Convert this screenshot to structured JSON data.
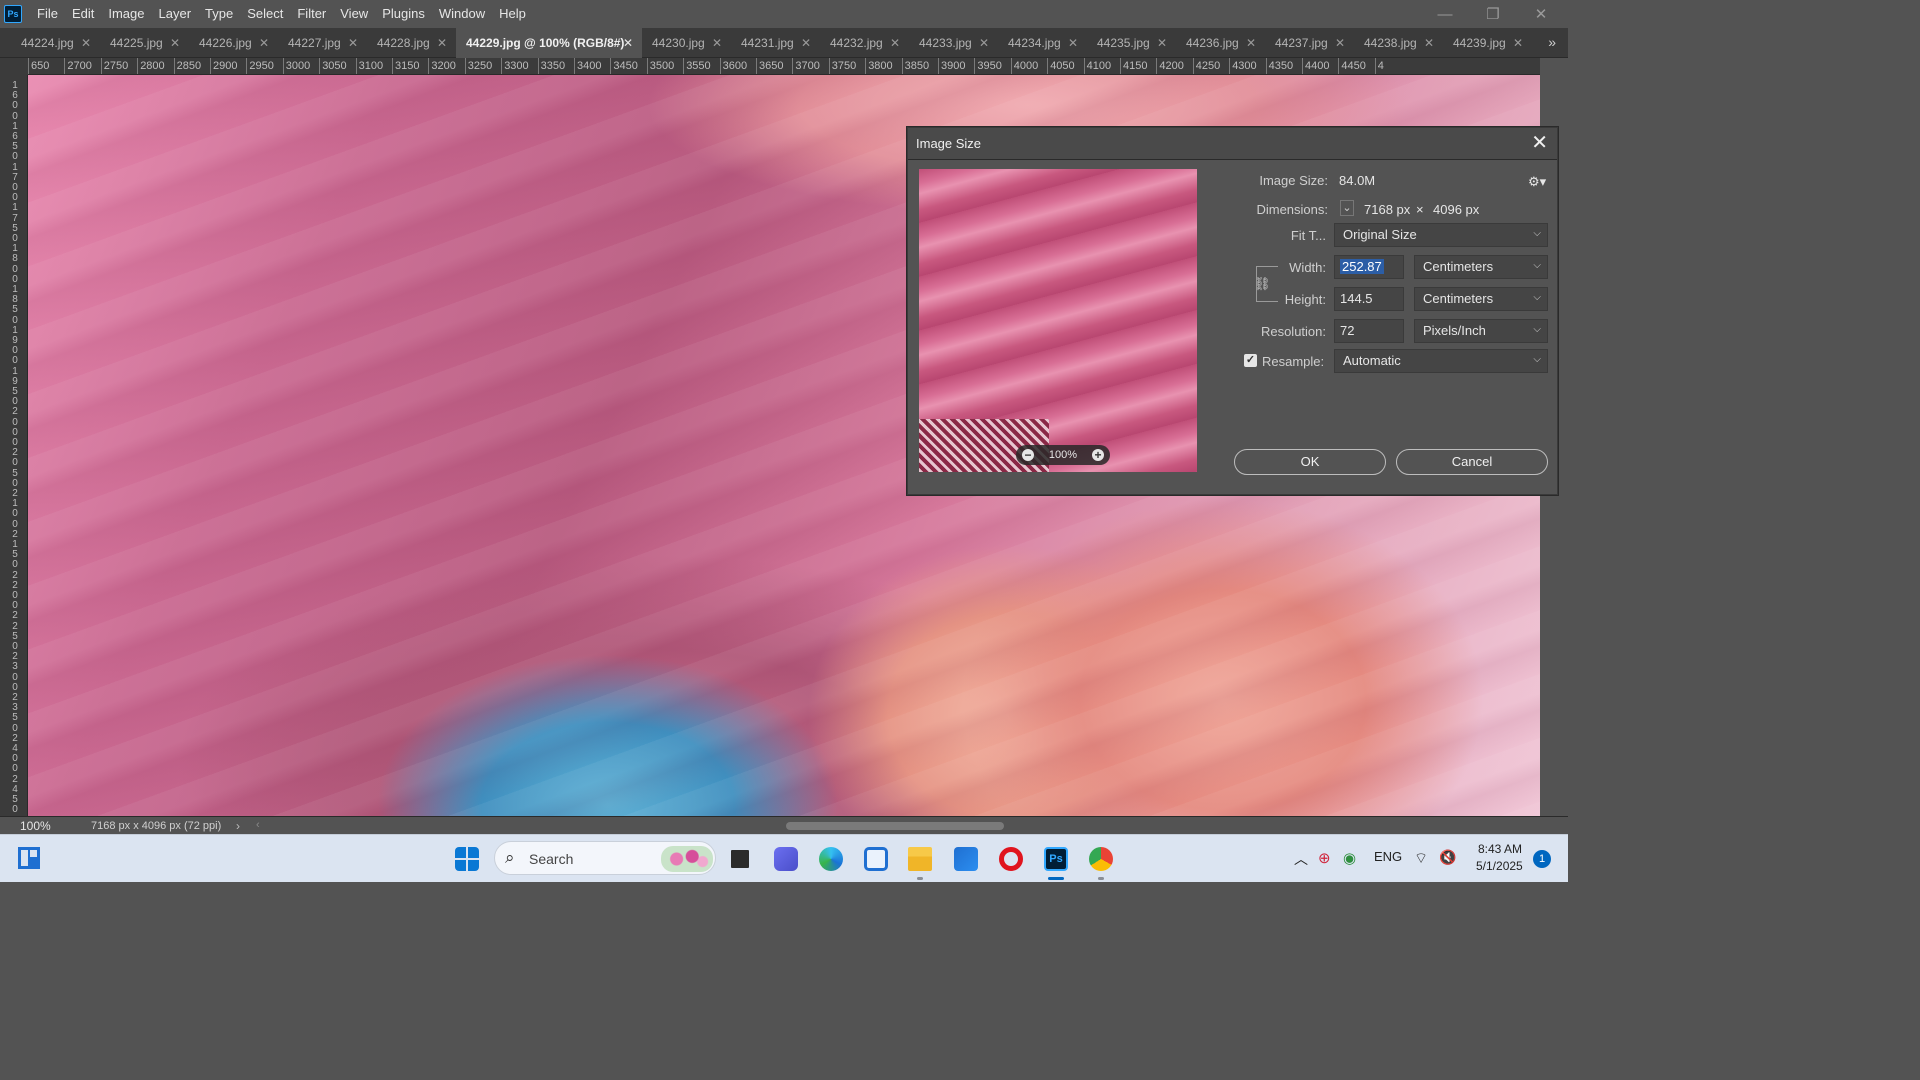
{
  "app": {
    "logo": "Ps",
    "menu": [
      "File",
      "Edit",
      "Image",
      "Layer",
      "Type",
      "Select",
      "Filter",
      "View",
      "Plugins",
      "Window",
      "Help"
    ],
    "window_controls": {
      "minimize": "—",
      "restore": "❐",
      "close": "✕"
    }
  },
  "tabs": [
    {
      "label": "44224.jpg",
      "active": false
    },
    {
      "label": "44225.jpg",
      "active": false
    },
    {
      "label": "44226.jpg",
      "active": false
    },
    {
      "label": "44227.jpg",
      "active": false
    },
    {
      "label": "44228.jpg",
      "active": false
    },
    {
      "label": "44229.jpg @ 100% (RGB/8#)",
      "active": true
    },
    {
      "label": "44230.jpg",
      "active": false
    },
    {
      "label": "44231.jpg",
      "active": false
    },
    {
      "label": "44232.jpg",
      "active": false
    },
    {
      "label": "44233.jpg",
      "active": false
    },
    {
      "label": "44234.jpg",
      "active": false
    },
    {
      "label": "44235.jpg",
      "active": false
    },
    {
      "label": "44236.jpg",
      "active": false
    },
    {
      "label": "44237.jpg",
      "active": false
    },
    {
      "label": "44238.jpg",
      "active": false
    },
    {
      "label": "44239.jpg",
      "active": false
    }
  ],
  "ruler": {
    "horizontal": [
      "650",
      "2700",
      "2750",
      "2800",
      "2850",
      "2900",
      "2950",
      "3000",
      "3050",
      "3100",
      "3150",
      "3200",
      "3250",
      "3300",
      "3350",
      "3400",
      "3450",
      "3500",
      "3550",
      "3600",
      "3650",
      "3700",
      "3750",
      "3800",
      "3850",
      "3900",
      "3950",
      "4000",
      "4050",
      "4100",
      "4150",
      "4200",
      "4250",
      "4300",
      "4350",
      "4400",
      "4450",
      "4"
    ],
    "vertical": [
      "1",
      "6",
      "0",
      "0",
      "1",
      "6",
      "5",
      "0",
      "1",
      "7",
      "0",
      "0",
      "1",
      "7",
      "5",
      "0",
      "1",
      "8",
      "0",
      "0",
      "1",
      "8",
      "5",
      "0",
      "1",
      "9",
      "0",
      "0",
      "1",
      "9",
      "5",
      "0",
      "2",
      "0",
      "0",
      "0",
      "2",
      "0",
      "5",
      "0",
      "2",
      "1",
      "0",
      "0",
      "2",
      "1",
      "5",
      "0",
      "2",
      "2",
      "0",
      "0",
      "2",
      "2",
      "5",
      "0",
      "2",
      "3",
      "0",
      "0",
      "2",
      "3",
      "5",
      "0",
      "2",
      "4",
      "0",
      "0",
      "2",
      "4",
      "5",
      "0"
    ]
  },
  "status": {
    "zoom": "100%",
    "doc_info": "7168 px x 4096 px (72 ppi)",
    "arrow": "›",
    "scroll_left": "‹"
  },
  "dialog": {
    "title": "Image Size",
    "close": "✕",
    "image_size_label": "Image Size:",
    "image_size_value": "84.0M",
    "dimensions_label": "Dimensions:",
    "dimensions_width": "7168 px",
    "dimensions_x": "×",
    "dimensions_height": "4096 px",
    "fit_to_label": "Fit T...",
    "fit_to_value": "Original Size",
    "width_label": "Width:",
    "width_value": "252.87",
    "width_unit": "Centimeters",
    "height_label": "Height:",
    "height_value": "144.5",
    "height_unit": "Centimeters",
    "resolution_label": "Resolution:",
    "resolution_value": "72",
    "resolution_unit": "Pixels/Inch",
    "resample_label": "Resample:",
    "resample_checked": true,
    "resample_value": "Automatic",
    "preview_zoom": "100%",
    "ok": "OK",
    "cancel": "Cancel"
  },
  "taskbar": {
    "search_placeholder": "Search",
    "language": "ENG",
    "time": "8:43 AM",
    "date": "5/1/2025",
    "notifications": "1"
  },
  "colors": {
    "accent": "#2c5ea6",
    "photoshop_blue": "#31a8ff",
    "windows_blue": "#0067c0"
  }
}
